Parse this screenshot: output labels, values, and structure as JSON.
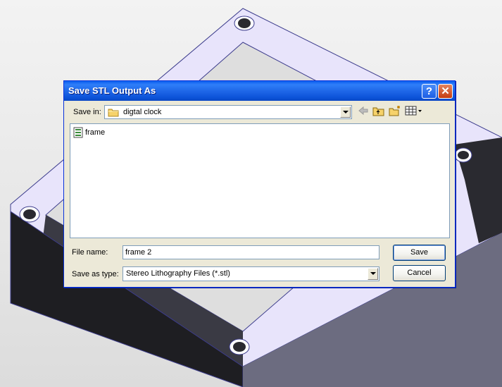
{
  "dialog": {
    "title": "Save STL Output As",
    "help_symbol": "?",
    "close_symbol": "✕",
    "save_in_label": "Save in:",
    "save_in_value": "digtal clock",
    "file_name_label": "File name:",
    "file_name_value": "frame 2",
    "save_as_type_label": "Save as type:",
    "save_as_type_value": "Stereo Lithography Files (*.stl)",
    "save_button": "Save",
    "cancel_button": "Cancel",
    "files": [
      {
        "name": "frame",
        "icon": "stl-file-icon"
      }
    ],
    "toolbar_icons": [
      "back-arrow-icon",
      "up-folder-icon",
      "new-folder-icon",
      "view-menu-icon"
    ]
  },
  "colors": {
    "title_bar": "#0a5ef0",
    "dialog_bg": "#ece9d8",
    "model_face": "#e8e4fb",
    "model_side": "#1e1e22",
    "model_edge": "#3c3c8c"
  }
}
